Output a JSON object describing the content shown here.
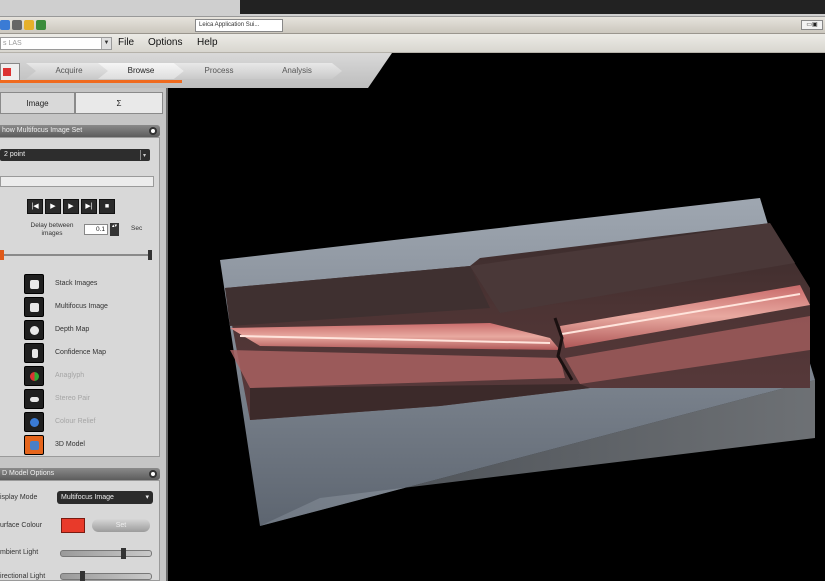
{
  "window": {
    "app_tab_label": "Leica Application Sui...",
    "control_glyph": "▭▣"
  },
  "menubar": {
    "combo_value": "s LAS",
    "combo_arrow": "▼",
    "items": [
      "File",
      "Options",
      "Help"
    ]
  },
  "workflow": {
    "tabs": [
      "Acquire",
      "Browse",
      "Process",
      "Analysis"
    ],
    "active": "Browse"
  },
  "subtabs": [
    "Image",
    "Σ"
  ],
  "multifocus": {
    "header": "how Multifocus Image Set",
    "dropdown": "2 point",
    "dropdown_arrow": "▾",
    "controls": [
      "|◀",
      "▶",
      "▶",
      "▶|",
      "■"
    ],
    "delay_label": "Delay between images",
    "delay_value": "0.1",
    "spin_glyph": "▴▾",
    "delay_unit": "Sec"
  },
  "view_items": [
    {
      "label": "Stack Images",
      "enabled": true,
      "icon": "stack-images-icon"
    },
    {
      "label": "Multifocus Image",
      "enabled": true,
      "icon": "multifocus-image-icon"
    },
    {
      "label": "Depth Map",
      "enabled": true,
      "icon": "depth-map-icon"
    },
    {
      "label": "Confidence Map",
      "enabled": true,
      "icon": "confidence-map-icon"
    },
    {
      "label": "Anaglyph",
      "enabled": false,
      "icon": "anaglyph-icon"
    },
    {
      "label": "Stereo Pair",
      "enabled": false,
      "icon": "stereo-pair-icon"
    },
    {
      "label": "Colour Relief",
      "enabled": false,
      "icon": "colour-relief-icon"
    },
    {
      "label": "3D Model",
      "enabled": true,
      "icon": "3d-model-icon",
      "selected": true
    }
  ],
  "model_options": {
    "header": "D Model Options",
    "display_mode_label": "isplay Mode",
    "display_mode_value": "Multifocus Image",
    "display_mode_arrow": "▾",
    "surface_colour_label": "urface Colour",
    "surface_colour": "#e83a2a",
    "set_label": "Set",
    "ambient_light_label": "mbient Light",
    "ambient_light_level": 0.7,
    "directional_light_label": "irectional Light",
    "directional_light_level": 0.22
  },
  "colors": {
    "accent": "#f06a1e",
    "panel": "#c5c5c5",
    "viewport_bg": "#000000"
  }
}
